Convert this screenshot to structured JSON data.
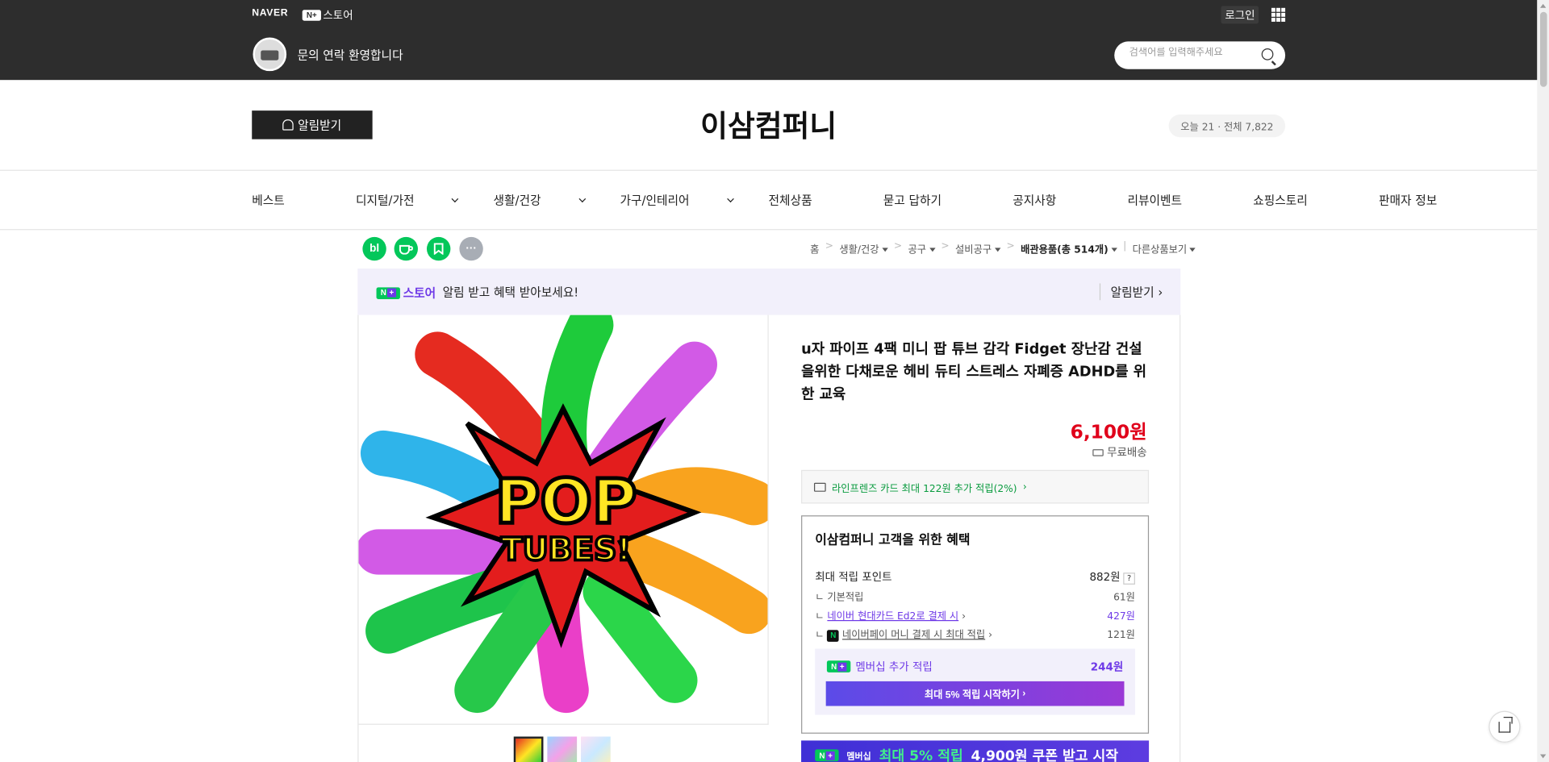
{
  "gnb": {
    "naver": "NAVER",
    "nplus": "N+",
    "store": "스토어",
    "login": "로그인",
    "welcome": "문의 연락 환영합니다",
    "search_placeholder": "검색어를 입력해주세요"
  },
  "header": {
    "alarm_button": "알림받기",
    "store_name": "이삼컴퍼니",
    "visit_today": "오늘 21",
    "visit_total": "전체 7,822"
  },
  "nav": {
    "items": [
      "베스트",
      "디지털/가전",
      "생활/건강",
      "가구/인테리어",
      "전체상품",
      "묻고 답하기",
      "공지사항",
      "리뷰이벤트",
      "쇼핑스토리",
      "판매자 정보"
    ]
  },
  "share_icons": [
    "blog-icon",
    "cafe-icon",
    "bookmark-icon",
    "more-icon"
  ],
  "breadcrumb": {
    "items": [
      "홈",
      "생활/건강",
      "공구",
      "설비공구",
      "배관용품(총 514개)",
      "다른상품보기"
    ]
  },
  "nbanner": {
    "brand": "스토어",
    "message": "알림 받고 혜택 받아보세요!",
    "alarm": "알림받기"
  },
  "product": {
    "title": "u자 파이프 4팩 미니 팝 튜브 감각 Fidget 장난감 건설을위한 다채로운 헤비 듀티 스트레스 자폐증 ADHD를 위한 교육",
    "price": "6,100원",
    "shipping": "무료배송",
    "card_benefit": "라인프렌즈 카드 최대 122원 추가 적립(2%)",
    "image_text": [
      "POP",
      "TUBES!"
    ]
  },
  "benefit": {
    "title": "이삼컴퍼니 고객을 위한 혜택",
    "max_point_label": "최대 적립 포인트",
    "max_point_value": "882원",
    "rows": [
      {
        "label": "기본적립",
        "value": "61원"
      },
      {
        "label": "네이버 현대카드 Ed2로 결제 시",
        "value": "427원"
      },
      {
        "label": "네이버페이 머니 결제 시 최대 적립",
        "value": "121원"
      }
    ],
    "membership_label": "멤버십 추가 적립",
    "membership_value": "244원",
    "membership_button": "최대 5% 적립 시작하기",
    "band_badge": "멤버십",
    "band_text": "최대 5% 적립",
    "band_text2": "4,900원 쿠폰 받고 시작"
  },
  "colors": {
    "accent_green": "#03c75a",
    "accent_purple": "#6e39e7",
    "price_red": "#e0001a"
  }
}
